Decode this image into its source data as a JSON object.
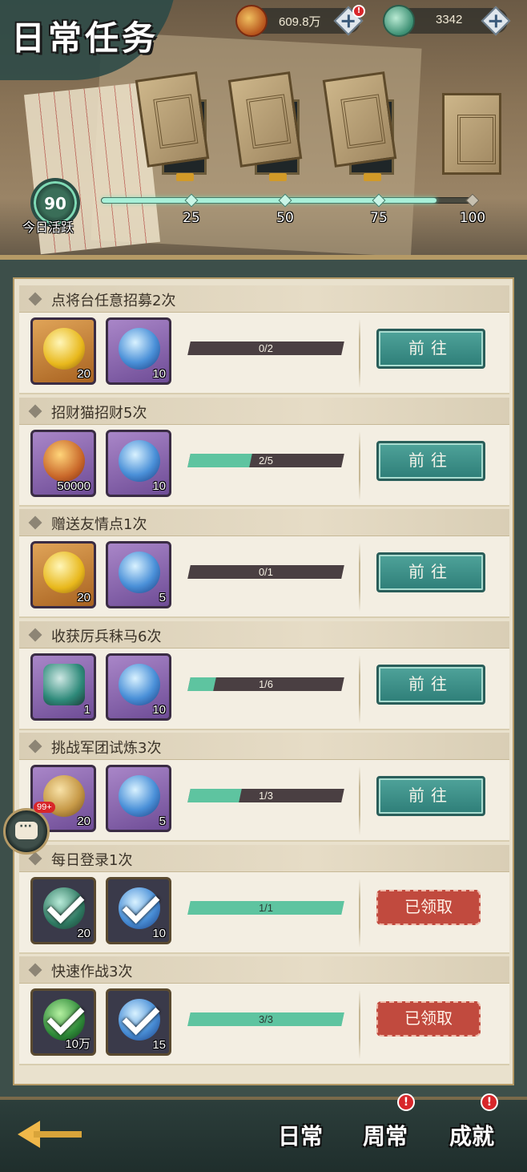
{
  "header": {
    "title": "日常任务",
    "resources": {
      "coin": {
        "value": "609.8万",
        "icon": "copper-coin-icon"
      },
      "jade": {
        "value": "3342",
        "icon": "jade-dragon-icon"
      }
    },
    "activity": {
      "label": "今日活跃",
      "value": "90",
      "max": 100,
      "milestones": [
        {
          "value": "25",
          "reached": true
        },
        {
          "value": "50",
          "reached": true
        },
        {
          "value": "75",
          "reached": true
        },
        {
          "value": "100",
          "reached": false
        }
      ]
    }
  },
  "tasks": [
    {
      "title": "点将台任意招募2次",
      "rewards": [
        {
          "icon": "gold-orb-icon",
          "qty": "20"
        },
        {
          "icon": "silver-dragon-orb-icon",
          "qty": "10"
        }
      ],
      "progress_text": "0/2",
      "progress": 0.0,
      "action": "前往",
      "status": "go"
    },
    {
      "title": "招财猫招财5次",
      "rewards": [
        {
          "icon": "copper-coins-icon",
          "qty": "50000"
        },
        {
          "icon": "silver-dragon-orb-icon",
          "qty": "10"
        }
      ],
      "progress_text": "2/5",
      "progress": 0.4,
      "action": "前往",
      "status": "go"
    },
    {
      "title": "赠送友情点1次",
      "rewards": [
        {
          "icon": "gold-orb-icon",
          "qty": "20"
        },
        {
          "icon": "silver-dragon-orb-icon",
          "qty": "5"
        }
      ],
      "progress_text": "0/1",
      "progress": 0.0,
      "action": "前往",
      "status": "go"
    },
    {
      "title": "收获厉兵秣马6次",
      "rewards": [
        {
          "icon": "blade-icon",
          "qty": "1"
        },
        {
          "icon": "silver-dragon-orb-icon",
          "qty": "10"
        }
      ],
      "progress_text": "1/6",
      "progress": 0.1667,
      "action": "前往",
      "status": "go"
    },
    {
      "title": "挑战军团试炼3次",
      "rewards": [
        {
          "icon": "bronze-medal-icon",
          "qty": "20"
        },
        {
          "icon": "silver-dragon-orb-icon",
          "qty": "5"
        }
      ],
      "progress_text": "1/3",
      "progress": 0.3333,
      "action": "前往",
      "status": "go"
    },
    {
      "title": "每日登录1次",
      "rewards": [
        {
          "icon": "jade-dragon-icon",
          "qty": "20",
          "claimed": true
        },
        {
          "icon": "silver-dragon-orb-icon",
          "qty": "10",
          "claimed": true
        }
      ],
      "progress_text": "1/1",
      "progress": 1.0,
      "action": "已领取",
      "status": "claimed"
    },
    {
      "title": "快速作战3次",
      "rewards": [
        {
          "icon": "green-orb-icon",
          "qty": "10万",
          "claimed": true
        },
        {
          "icon": "silver-dragon-orb-icon",
          "qty": "15",
          "claimed": true
        }
      ],
      "progress_text": "3/3",
      "progress": 1.0,
      "action": "已领取",
      "status": "claimed"
    }
  ],
  "chat": {
    "badge": "99+"
  },
  "footer": {
    "tabs": [
      {
        "label": "日常",
        "active": true,
        "alert": false
      },
      {
        "label": "周常",
        "active": false,
        "alert": true
      },
      {
        "label": "成就",
        "active": false,
        "alert": true
      }
    ]
  },
  "colors": {
    "progress_fill": "#5ec4a0",
    "go_button": "#3a918a",
    "claimed_button": "#c14a3e",
    "alert": "#d8262a"
  }
}
